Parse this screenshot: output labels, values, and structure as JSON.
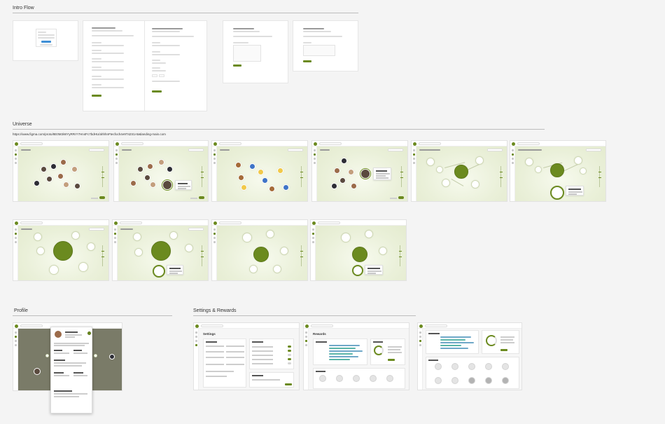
{
  "sections": {
    "intro": "Intro Flow",
    "universe": "Universe",
    "universe_url": "https://www.figma.com/proto/8E0M3iWYyRRrY7Hn4Fc7bdHU/ahhhnFtecfoch4e9T4Z41A5&landing-main.com",
    "profile": "Profile",
    "settings": "Settings & Rewards"
  },
  "screens": {
    "settings_title": "Settings",
    "rewards_title": "Rewards"
  },
  "colors": {
    "accent": "#6b8a1f",
    "stage": "#eaf0d9",
    "bar_blue": "#6fa8c8",
    "bar_teal": "#5bb5a8"
  }
}
